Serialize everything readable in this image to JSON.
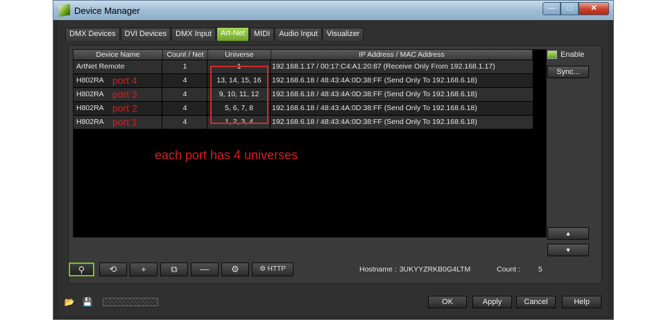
{
  "window": {
    "title": "Device Manager",
    "caption": {
      "minimize": "—",
      "maximize": "□",
      "close": "✕"
    }
  },
  "tabs": [
    {
      "label": "DMX Devices",
      "active": false
    },
    {
      "label": "DVI Devices",
      "active": false
    },
    {
      "label": "DMX Input",
      "active": false
    },
    {
      "label": "Art-Net",
      "active": true
    },
    {
      "label": "MIDI",
      "active": false
    },
    {
      "label": "Audio Input",
      "active": false
    },
    {
      "label": "Visualizer",
      "active": false
    }
  ],
  "table": {
    "columns": [
      "Device Name",
      "Count / Net",
      "Universe",
      "IP Address / MAC Address"
    ],
    "rows": [
      {
        "name": "ArtNet Remote",
        "port_note": "",
        "count": "1",
        "universe": "1",
        "address": "192.168.1.17 / 00:17:C4:A1:20:87 (Receive Only From 192.168.1.17)"
      },
      {
        "name": "H802RA",
        "port_note": "port 4",
        "count": "4",
        "universe": "13, 14, 15, 16",
        "address": "192.168.6.18 / 48:43:4A:0D:38:FF (Send Only To 192.168.6.18)"
      },
      {
        "name": "H802RA",
        "port_note": "port 3",
        "count": "4",
        "universe": "9, 10, 11, 12",
        "address": "192.168.6.18 / 48:43:4A:0D:38:FF (Send Only To 192.168.6.18)"
      },
      {
        "name": "H802RA",
        "port_note": "port 2",
        "count": "4",
        "universe": "5, 6, 7, 8",
        "address": "192.168.6.18 / 48:43:4A:0D:38:FF (Send Only To 192.168.6.18)"
      },
      {
        "name": "H802RA",
        "port_note": "port 1",
        "count": "4",
        "universe": "1, 2, 3, 4",
        "address": "192.168.6.18 / 48:43:4A:0D:38:FF (Send Only To 192.168.6.18)"
      }
    ]
  },
  "annotation": "each port has 4 universes",
  "side": {
    "enable_label": "Enable",
    "enable_checked": true,
    "sync_label": "Sync...",
    "up_label": "▲",
    "down_label": "▼"
  },
  "toolbar": {
    "search_icon": "⚲",
    "refresh_icon": "⟲",
    "add_icon": "+",
    "copy_icon": "⧉",
    "remove_icon": "—",
    "settings_icon": "⚙",
    "http_label": "⚙ HTTP"
  },
  "status": {
    "hostname_label": "Hostname :",
    "hostname_value": "3UKYYZRKB0G4LTM",
    "count_label": "Count :",
    "count_value": "5"
  },
  "footer": {
    "open_icon": "📂",
    "save_icon": "💾",
    "ok": "OK",
    "apply": "Apply",
    "cancel": "Cancel",
    "help": "Help"
  },
  "colors": {
    "accent": "#7cc12b",
    "annotation": "#d61f1f"
  }
}
